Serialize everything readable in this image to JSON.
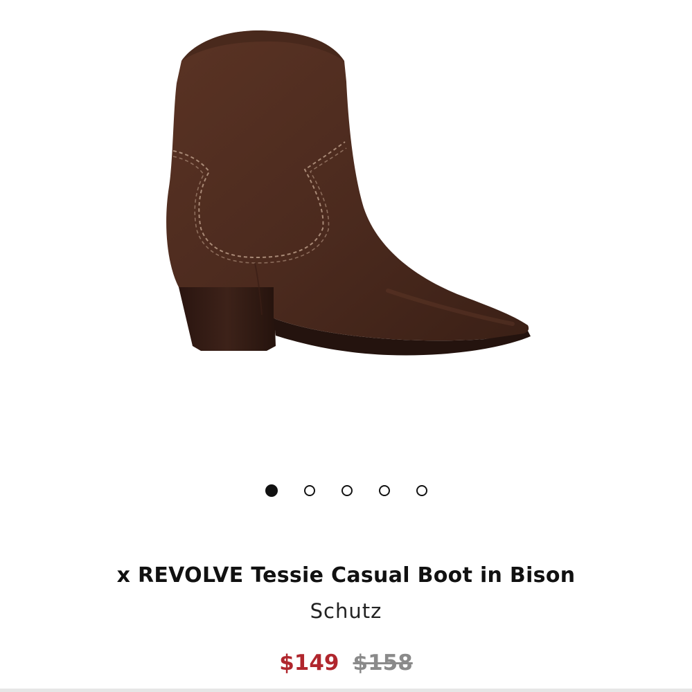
{
  "product": {
    "image_alt": "Schutz x REVOLVE Tessie Casual Boot in Bison",
    "image_colors": {
      "suede": "#4e2b1f",
      "suede_dark": "#3a1e15",
      "stitch": "#b89a86",
      "heel": "#2c1812",
      "sole": "#24130e"
    },
    "title": "x REVOLVE Tessie Casual Boot in Bison",
    "brand": "Schutz",
    "sale_price": "$149",
    "original_price": "$158",
    "sale_color": "#b0262d"
  },
  "carousel": {
    "total_images": 5,
    "active_index": 0,
    "dots": [
      {
        "label": "Image 1"
      },
      {
        "label": "Image 2"
      },
      {
        "label": "Image 3"
      },
      {
        "label": "Image 4"
      },
      {
        "label": "Image 5"
      }
    ]
  }
}
